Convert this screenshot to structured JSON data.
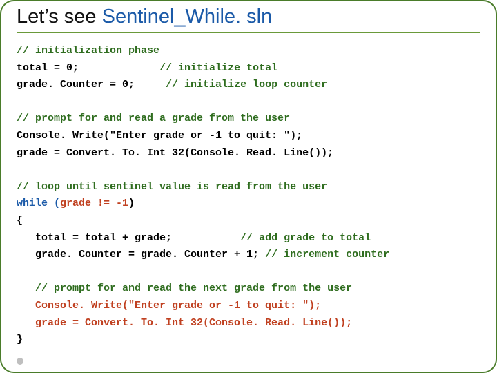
{
  "title": {
    "prefix": "Let’s see ",
    "link": "Sentinel_While. sln"
  },
  "code": {
    "l01_c": "// initialization phase",
    "l02_a": "total = 0;             ",
    "l02_c": "// initialize total",
    "l03_a": "grade. Counter = 0;     ",
    "l03_c": "// initialize loop counter",
    "l05_c": "// prompt for and read a grade from the user",
    "l06": "Console. Write(\"Enter grade or -1 to quit: \");",
    "l07": "grade = Convert. To. Int 32(Console. Read. Line());",
    "l09_c": "// loop until sentinel value is read from the user",
    "l10_a": "while (",
    "l10_b": "grade != -1",
    "l10_c": ")",
    "l11": "{",
    "l12_a": "   total = total + grade;           ",
    "l12_c": "// add grade to total",
    "l13_a": "   grade. Counter = grade. Counter + 1; ",
    "l13_c": "// increment counter",
    "l15_c": "   // prompt for and read the next grade from the user",
    "l16": "   Console. Write(\"Enter grade or -1 to quit: \");",
    "l17": "   grade = Convert. To. Int 32(Console. Read. Line());",
    "l18": "}"
  }
}
